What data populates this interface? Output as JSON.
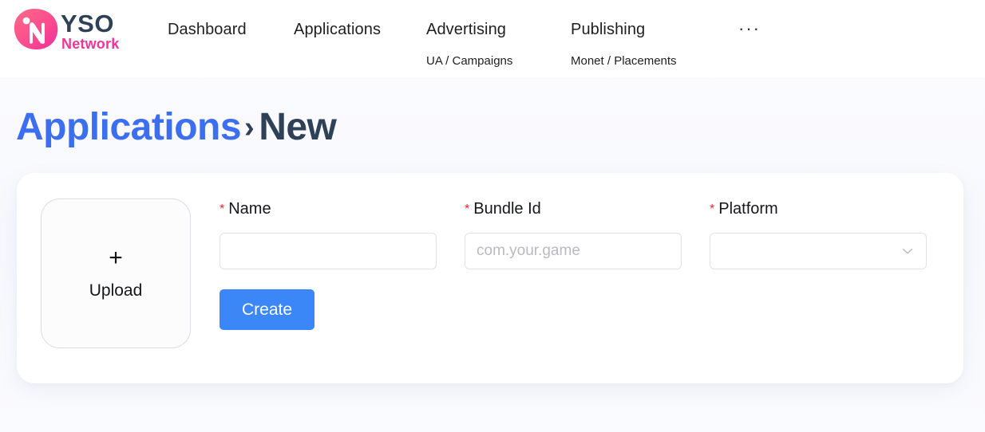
{
  "brand": {
    "name_primary": "YSO",
    "name_secondary": "Network",
    "mark_letter": "N",
    "colors": {
      "logo_pink_start": "#ff5f8f",
      "logo_pink_end": "#f0359a",
      "logo_text_dark": "#2f4156",
      "logo_text_pink": "#f0359a"
    }
  },
  "header": {
    "nav": [
      {
        "label": "Dashboard",
        "sub": ""
      },
      {
        "label": "Applications",
        "sub": ""
      },
      {
        "label": "Advertising",
        "sub": "UA / Campaigns"
      },
      {
        "label": "Publishing",
        "sub": "Monet / Placements"
      }
    ],
    "overflow_label": "···"
  },
  "breadcrumb": {
    "parent": "Applications",
    "separator": "›",
    "current": "New",
    "parent_color": "#3c6ef0",
    "current_color": "#2f4156"
  },
  "form": {
    "upload": {
      "plus_icon": "+",
      "label": "Upload"
    },
    "fields": [
      {
        "label": "Name",
        "required_marker": "*",
        "value": "",
        "placeholder": "",
        "type": "text"
      },
      {
        "label": "Bundle Id",
        "required_marker": "*",
        "value": "",
        "placeholder": "com.your.game",
        "type": "text"
      },
      {
        "label": "Platform",
        "required_marker": "*",
        "value": "",
        "placeholder": "",
        "type": "select",
        "chevron_icon": "chevron-down-icon"
      }
    ],
    "submit": {
      "label": "Create",
      "color": "#3b87f7"
    }
  }
}
